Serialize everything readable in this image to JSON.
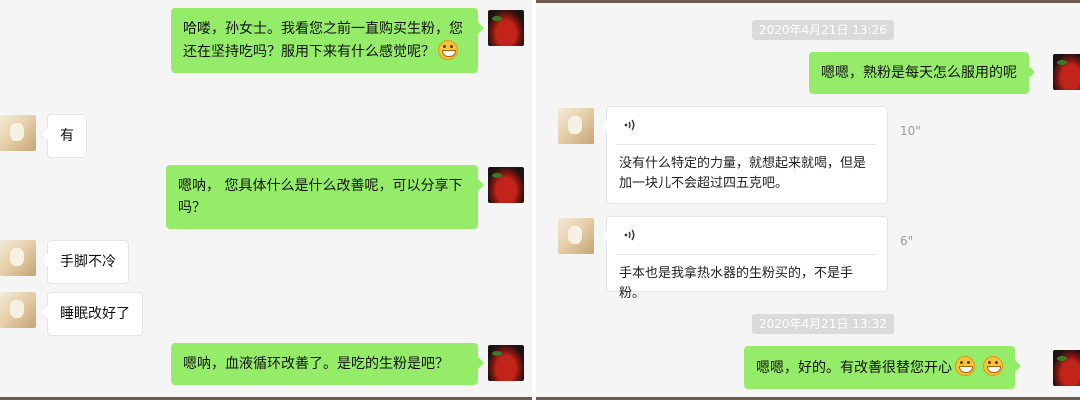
{
  "left_panel": {
    "messages": [
      {
        "side": "right",
        "avatar": "berry-bowl-avatar",
        "text": "哈喽，孙女士。我看您之前一直购买生粉，您还在坚持吃吗？服用下来有什么感觉呢？",
        "emoji": "grinning-emoji"
      },
      {
        "side": "left",
        "avatar": "person-avatar",
        "text": "有"
      },
      {
        "side": "right",
        "avatar": "berry-bowl-avatar",
        "text": "嗯呐， 您具体什么是什么改善呢，可以分享下吗？"
      },
      {
        "side": "left",
        "avatar": "person-avatar",
        "text": "手脚不冷"
      },
      {
        "side": "left",
        "avatar": "person-avatar",
        "text": "睡眠改好了"
      },
      {
        "side": "right",
        "avatar": "berry-bowl-avatar",
        "text": "嗯呐，血液循环改善了。是吃的生粉是吧？"
      }
    ]
  },
  "right_panel": {
    "timestamp_1": "2020年4月21日 13:26",
    "msg_1": "嗯嗯，熟粉是每天怎么服用的呢",
    "voice_1": {
      "transcript": "没有什么特定的力量，就想起来就喝，但是加一块儿不会超过四五克吧。",
      "duration": "10\""
    },
    "voice_2": {
      "transcript": "手本也是我拿热水器的生粉买的，不是手粉。",
      "duration": "6\""
    },
    "timestamp_2": "2020年4月21日 13:32",
    "msg_2": "嗯嗯，好的。有改善很替您开心",
    "msg_2_emojis": [
      "grinning-emoji",
      "grinning-emoji"
    ]
  },
  "colors": {
    "outgoing_bubble": "#95ec69",
    "incoming_bubble": "#ffffff",
    "chat_background": "#f5f5f5",
    "timestamp_chip": "#dadada"
  }
}
